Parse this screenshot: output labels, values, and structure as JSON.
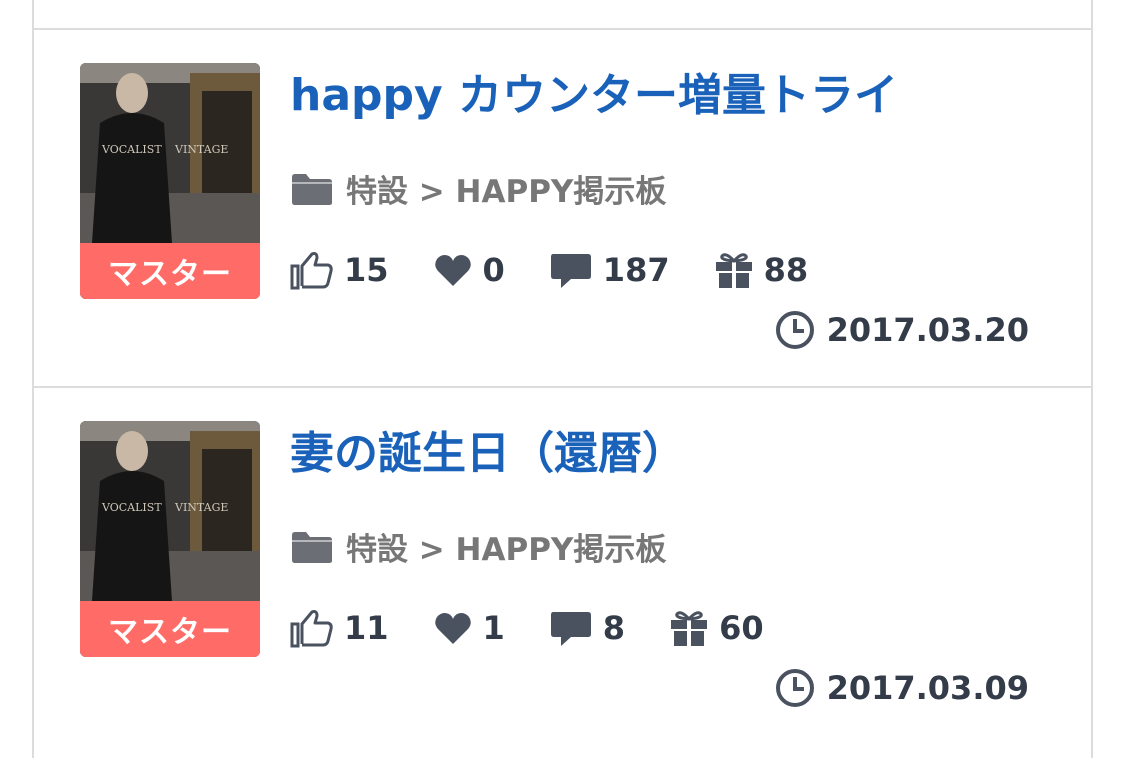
{
  "posts": [
    {
      "title": "happy カウンター増量トライ",
      "badge": "マスター",
      "category": "特設 > HAPPY掲示板",
      "likes": "15",
      "favorites": "0",
      "comments": "187",
      "gifts": "88",
      "date": "2017.03.20"
    },
    {
      "title": "妻の誕生日（還暦）",
      "badge": "マスター",
      "category": "特設 > HAPPY掲示板",
      "likes": "11",
      "favorites": "1",
      "comments": "8",
      "gifts": "60",
      "date": "2017.03.09"
    }
  ],
  "colors": {
    "title": "#1a62b9",
    "badge": "#ff6b66",
    "category": "#777777",
    "stats": "#333c48",
    "divider": "#dcdcdc"
  },
  "icons": [
    "folder-icon",
    "thumbs-up-icon",
    "heart-icon",
    "comment-icon",
    "gift-icon",
    "clock-icon"
  ]
}
